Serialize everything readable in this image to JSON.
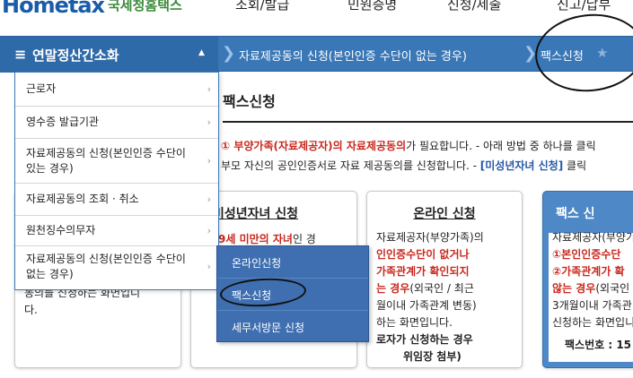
{
  "header": {
    "logo": "Hometax",
    "logo_sub": "국세청홈택스",
    "nav": [
      "조회/발급",
      "민원증명",
      "신청/제출",
      "신고/납부"
    ]
  },
  "breadcrumb": {
    "menu_title": "연말정산간소화",
    "item1": "자료제공동의 신청(본인인증 수단이 없는 경우)",
    "item2": "팩스신청"
  },
  "page": {
    "title": "팩스신청",
    "desc1_pre": "① 부양가족(자료제공자)의 자료제공동의",
    "desc1_post": "가 필요합니다. - 아래 방법 중 하나를 클릭",
    "desc2_pre": "부모 자신의 공인인증서로 자료 제공동의를 신청합니다. - ",
    "desc2_link": "[미성년자녀 신청]",
    "desc2_post": " 클릭"
  },
  "sidebar_menu": {
    "items": [
      {
        "label": "근로자"
      },
      {
        "label": "영수증 발급기관"
      },
      {
        "label": "자료제공동의 신청(본인인증 수단이 있는 경우)"
      },
      {
        "label": "자료제공동의 조회 · 취소"
      },
      {
        "label": "원천징수의무자"
      },
      {
        "label": "자료제공동의 신청(본인인증 수단이 없는 경우)"
      }
    ]
  },
  "submenu": {
    "items": [
      {
        "label": "온라인신청"
      },
      {
        "label": "팩스신청"
      },
      {
        "label": "세무서방문 신청"
      }
    ]
  },
  "cards": {
    "left_body": "동의를 신청하는 화면입니\n다.",
    "minor": {
      "title": "미성년자녀 신청",
      "line1_red": "9세 미만의 자녀",
      "line1_post": "인 경"
    },
    "online": {
      "title": "온라인 신청",
      "line1": "자료제공자(부양가족)의",
      "line2": "인인증수단이 없거나",
      "line3": "가족관계가 확인되지",
      "line4_red": "는 경우",
      "line4_post": "(외국인 / 최근",
      "line5": "월이내 가족관계 변동)",
      "line6": "하는 화면입니다.",
      "line7": "로자가 신청하는 경우",
      "line8": "위임장 첨부)"
    },
    "fax": {
      "title": "팩스 신",
      "line1": "자료제공자(부양가",
      "line2": "①본인인증수단",
      "line3": "②가족관계가 확",
      "line4_red": "않는 경우",
      "line4_post": "(외국인",
      "line5": "3개월이내 가족관",
      "line6": "신청하는 화면입니",
      "line7": "팩스번호 : 15"
    }
  }
}
